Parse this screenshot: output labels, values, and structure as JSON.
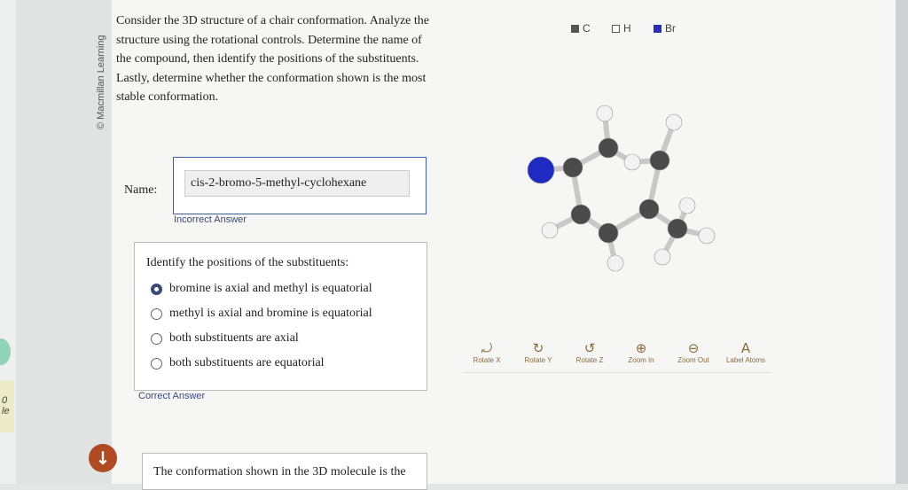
{
  "credit": "© Macmillan Learning",
  "prompt": "Consider the 3D structure of a chair conformation. Analyze the structure using the rotational controls. Determine the name of the compound, then identify the positions of the substituents. Lastly, determine whether the conformation shown is the most stable conformation.",
  "name_label": "Name:",
  "name_value": "cis-2-bromo-5-methyl-cyclohexane",
  "name_feedback": "Incorrect Answer",
  "positions": {
    "title": "Identify the positions of the substituents:",
    "options": [
      "bromine is axial and methyl is equatorial",
      "methyl is axial and bromine is equatorial",
      "both substituents are axial",
      "both substituents are equatorial"
    ],
    "selected_index": 0,
    "feedback": "Correct Answer"
  },
  "bottom_question": "The conformation shown in the 3D molecule is the",
  "side_card": {
    "line1": "0",
    "line2": "le"
  },
  "legend": [
    {
      "label": "C",
      "color": "#555555"
    },
    {
      "label": "H",
      "color": "#ffffff"
    },
    {
      "label": "Br",
      "color": "#2a2fb8"
    }
  ],
  "controls": [
    {
      "label": "Rotate X",
      "icon": "rotate-x-icon",
      "glyph": "⤾"
    },
    {
      "label": "Rotate Y",
      "icon": "rotate-y-icon",
      "glyph": "↻"
    },
    {
      "label": "Rotate Z",
      "icon": "rotate-z-icon",
      "glyph": "↺"
    },
    {
      "label": "Zoom In",
      "icon": "zoom-in-icon",
      "glyph": "⊕"
    },
    {
      "label": "Zoom Out",
      "icon": "zoom-out-icon",
      "glyph": "⊖"
    },
    {
      "label": "Label Atoms",
      "icon": "label-atoms-icon",
      "glyph": "A"
    }
  ],
  "colors": {
    "accent": "#3a4a78",
    "control": "#8b6a3a",
    "down_button": "#b04a22"
  }
}
